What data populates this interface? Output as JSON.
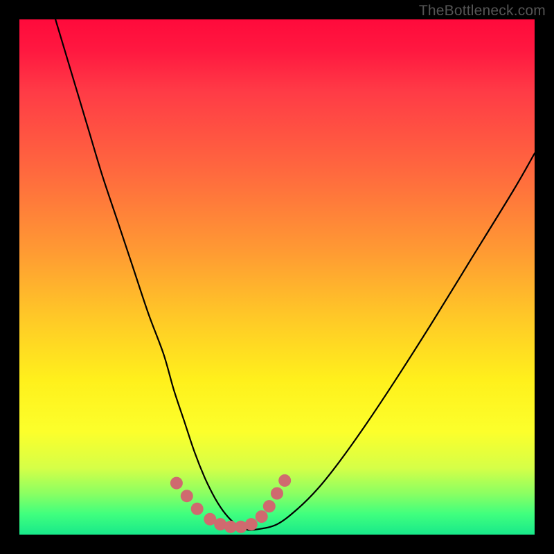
{
  "watermark": "TheBottleneck.com",
  "chart_data": {
    "type": "line",
    "title": "",
    "xlabel": "",
    "ylabel": "",
    "xlim": [
      0,
      100
    ],
    "ylim": [
      0,
      100
    ],
    "grid": false,
    "series": [
      {
        "name": "bottleneck-curve",
        "color": "#000000",
        "x": [
          7,
          10,
          13,
          16,
          19,
          22,
          25,
          28,
          30,
          32,
          34,
          36,
          38,
          40,
          42,
          44,
          46,
          50,
          54,
          58,
          62,
          67,
          73,
          80,
          88,
          96,
          100
        ],
        "values": [
          100,
          90,
          80,
          70,
          61,
          52,
          43,
          35,
          28,
          22,
          16,
          11,
          7,
          4,
          2,
          1,
          1,
          2,
          5,
          9,
          14,
          21,
          30,
          41,
          54,
          67,
          74
        ]
      },
      {
        "name": "highlight-dots",
        "color": "#cf6a6f",
        "x": [
          30.5,
          32.5,
          34.5,
          37,
          39,
          41,
          43,
          45,
          47,
          48.5,
          50,
          51.5
        ],
        "values": [
          10,
          7.5,
          5,
          3,
          2,
          1.5,
          1.5,
          2,
          3.5,
          5.5,
          8,
          10.5
        ]
      }
    ],
    "gradient_stops": [
      {
        "pos": 0,
        "color": "#ff0a3b"
      },
      {
        "pos": 30,
        "color": "#ff6a3e"
      },
      {
        "pos": 58,
        "color": "#ffc927"
      },
      {
        "pos": 80,
        "color": "#fcff2b"
      },
      {
        "pos": 100,
        "color": "#18e98a"
      }
    ]
  }
}
